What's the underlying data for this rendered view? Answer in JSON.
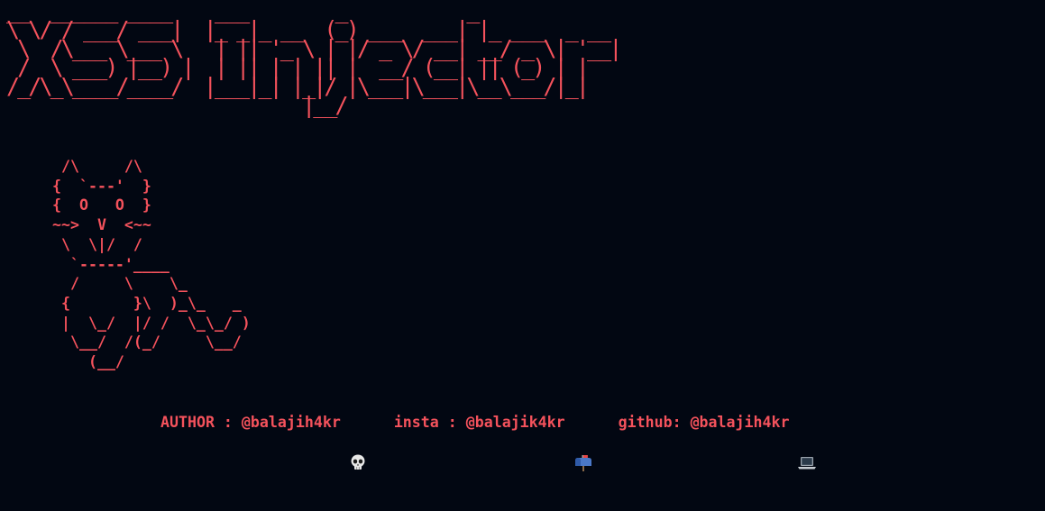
{
  "window": {
    "background": "#020712",
    "accent": "#f4525c"
  },
  "banner": {
    "lines": [
      "__  ______ ____    ___        _           _",
      "\\ \\/ / ___/ ___|  |_ _|_ __  (_) ___  ___| |_ ___  _ __",
      " \\  /\\___ \\___ \\   | || '_ \\ | |/ _ \\/ __| __/ _ \\| '__|",
      " /  \\ ___) |__) |  | || | | || |  __/ (__| || (_) | |",
      "/_/\\_\\____/____/  |___|_| |_|/ |\\___|\\___|\\__\\___/|_|",
      "                           |__/"
    ]
  },
  "cat": {
    "lines": [
      " /\\     /\\",
      "{  `---'  }",
      "{  O   O  }",
      "~~>  V  <~~",
      " \\  \\|/  /",
      "  `-----'____",
      "  /     \\    \\_",
      " {       }\\  )_\\_   _",
      " |  \\_/  |/ /  \\_\\_/ )",
      "  \\__/  /(_/     \\__/",
      "    (__/"
    ]
  },
  "credits": {
    "author": "AUTHOR : @balajih4kr",
    "author_icon": "skull-icon",
    "insta": "insta : @balajik4kr",
    "insta_icon": "mailbox-icon",
    "github": "github: @balajih4kr",
    "github_icon": "laptop-icon"
  }
}
